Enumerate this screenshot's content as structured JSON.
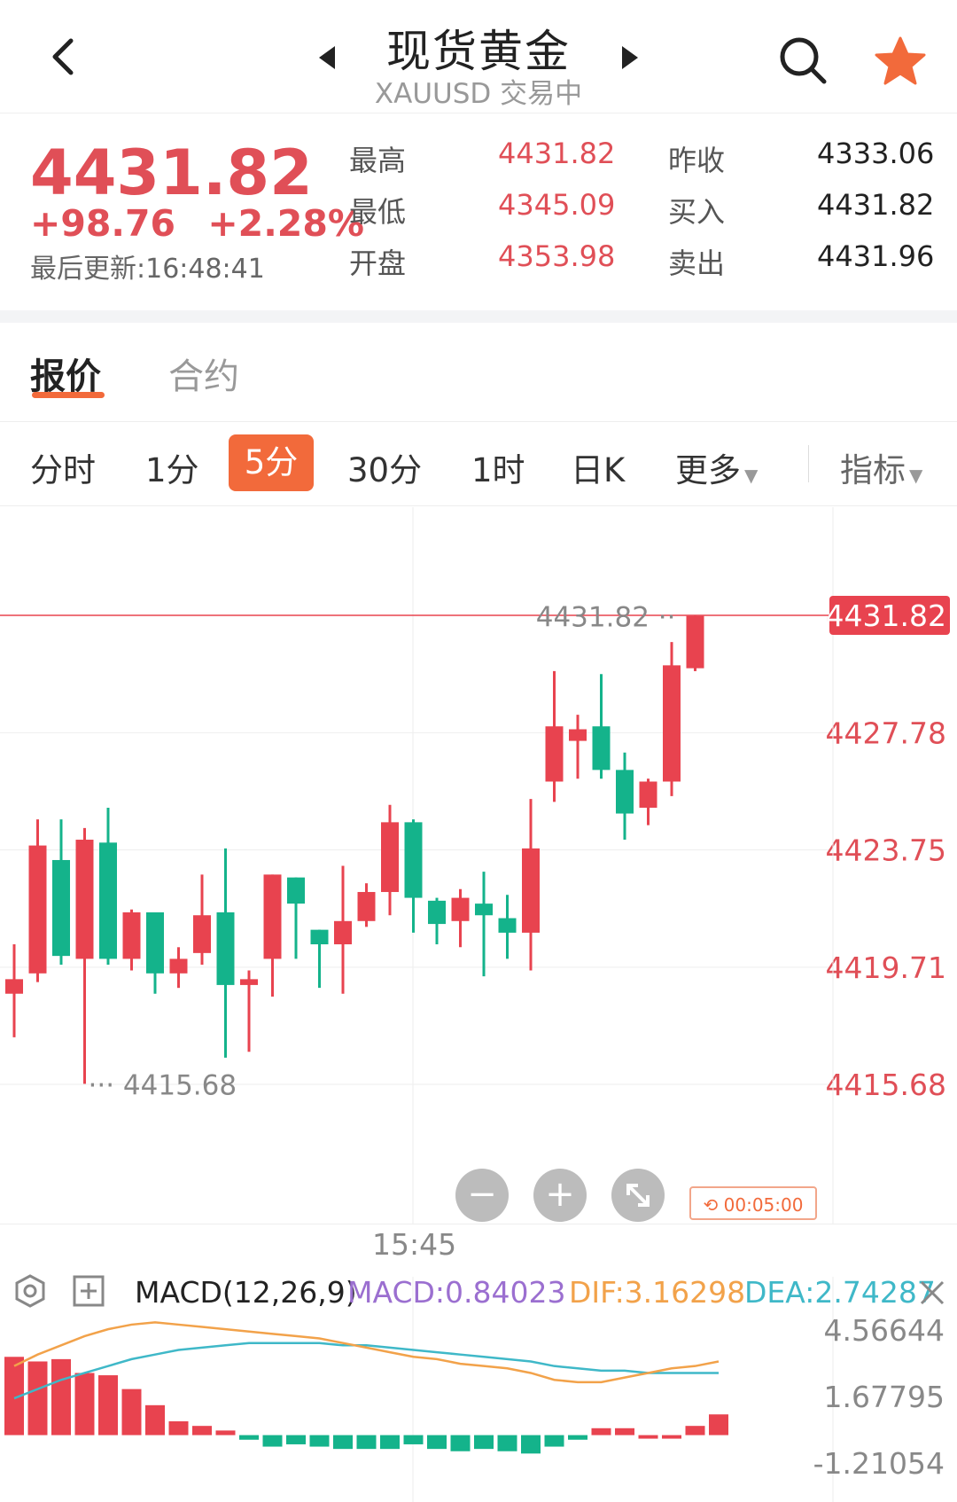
{
  "header": {
    "title": "现货黄金",
    "subtitle": "XAUUSD 交易中",
    "back_icon": "back-chevron-icon",
    "prev_icon": "prev-arrow-icon",
    "next_icon": "next-arrow-icon",
    "search_icon": "search-icon",
    "star_icon": "star-icon"
  },
  "quote": {
    "price": "4431.82",
    "change": "+98.76",
    "change_pct": "+2.28%",
    "updated": "最后更新:16:48:41",
    "high_label": "最高",
    "high": "4431.82",
    "low_label": "最低",
    "low": "4345.09",
    "open_label": "开盘",
    "open": "4353.98",
    "prev_close_label": "昨收",
    "prev_close": "4333.06",
    "bid_label": "买入",
    "bid": "4431.82",
    "ask_label": "卖出",
    "ask": "4431.96"
  },
  "tabs": [
    "报价",
    "合约"
  ],
  "intervals": [
    "分时",
    "1分",
    "5分",
    "30分",
    "1时",
    "日K",
    "更多",
    "指标"
  ],
  "selected_interval": "5分",
  "colors": {
    "up": "#e8434f",
    "down": "#14b38b",
    "accent": "#f26a3b",
    "dif": "#f2a24a",
    "dea": "#3fb8c8",
    "macd": "#9b6fd0"
  },
  "chart_data": {
    "type": "candlestick",
    "interval": "5分",
    "y_ticks": [
      "4431.82",
      "4427.78",
      "4423.75",
      "4419.71",
      "4415.68"
    ],
    "ylim": [
      4415.68,
      4431.82
    ],
    "current_price_label": "4431.82",
    "max_label": "4431.82",
    "min_label": "4415.68",
    "x_tick": "15:45",
    "candles": [
      {
        "open": 4418.8,
        "close": 4419.3,
        "high": 4420.5,
        "low": 4417.3
      },
      {
        "open": 4419.5,
        "close": 4423.9,
        "high": 4424.8,
        "low": 4419.2
      },
      {
        "open": 4423.4,
        "close": 4420.1,
        "high": 4424.8,
        "low": 4419.8
      },
      {
        "open": 4420.0,
        "close": 4424.1,
        "high": 4424.5,
        "low": 4415.7
      },
      {
        "open": 4424.0,
        "close": 4420.0,
        "high": 4425.2,
        "low": 4419.8
      },
      {
        "open": 4420.0,
        "close": 4421.6,
        "high": 4421.7,
        "low": 4419.6
      },
      {
        "open": 4421.6,
        "close": 4419.5,
        "high": 4421.6,
        "low": 4418.8
      },
      {
        "open": 4419.5,
        "close": 4420.0,
        "high": 4420.4,
        "low": 4419.0
      },
      {
        "open": 4420.2,
        "close": 4421.5,
        "high": 4422.9,
        "low": 4419.8
      },
      {
        "open": 4421.6,
        "close": 4419.1,
        "high": 4423.8,
        "low": 4416.6
      },
      {
        "open": 4419.1,
        "close": 4419.3,
        "high": 4419.6,
        "low": 4416.8
      },
      {
        "open": 4420.0,
        "close": 4422.9,
        "high": 4422.9,
        "low": 4418.7
      },
      {
        "open": 4422.8,
        "close": 4421.9,
        "high": 4422.8,
        "low": 4420.0
      },
      {
        "open": 4421.0,
        "close": 4420.5,
        "high": 4421.0,
        "low": 4419.0
      },
      {
        "open": 4420.5,
        "close": 4421.3,
        "high": 4423.2,
        "low": 4418.8
      },
      {
        "open": 4421.3,
        "close": 4422.3,
        "high": 4422.6,
        "low": 4421.1
      },
      {
        "open": 4422.3,
        "close": 4424.7,
        "high": 4425.3,
        "low": 4421.5
      },
      {
        "open": 4424.7,
        "close": 4422.1,
        "high": 4424.8,
        "low": 4420.9
      },
      {
        "open": 4422.0,
        "close": 4421.2,
        "high": 4422.1,
        "low": 4420.5
      },
      {
        "open": 4421.3,
        "close": 4422.1,
        "high": 4422.4,
        "low": 4420.4
      },
      {
        "open": 4421.9,
        "close": 4421.5,
        "high": 4423.0,
        "low": 4419.4
      },
      {
        "open": 4421.4,
        "close": 4420.9,
        "high": 4422.2,
        "low": 4420.0
      },
      {
        "open": 4420.9,
        "close": 4423.8,
        "high": 4425.5,
        "low": 4419.6
      },
      {
        "open": 4426.1,
        "close": 4428.0,
        "high": 4429.9,
        "low": 4425.4
      },
      {
        "open": 4427.5,
        "close": 4427.9,
        "high": 4428.4,
        "low": 4426.2
      },
      {
        "open": 4428.0,
        "close": 4426.5,
        "high": 4429.8,
        "low": 4426.2
      },
      {
        "open": 4426.5,
        "close": 4425.0,
        "high": 4427.1,
        "low": 4424.1
      },
      {
        "open": 4425.2,
        "close": 4426.1,
        "high": 4426.2,
        "low": 4424.6
      },
      {
        "open": 4426.1,
        "close": 4430.1,
        "high": 4430.9,
        "low": 4425.6
      },
      {
        "open": 4430.0,
        "close": 4431.8,
        "high": 4431.8,
        "low": 4429.9
      }
    ]
  },
  "macd": {
    "title": "MACD(12,26,9)",
    "macd_label": "MACD:0.84023",
    "dif_label": "DIF:3.16298",
    "dea_label": "DEA:2.74287",
    "close_icon": "close-icon",
    "settings_icon": "settings-icon",
    "add_icon": "add-icon",
    "y_ticks": [
      "4.56644",
      "1.67795",
      "-1.21054"
    ],
    "ylim": [
      -1.21054,
      4.56644
    ],
    "histogram": [
      3.4,
      3.2,
      3.3,
      2.7,
      2.6,
      2.0,
      1.3,
      0.6,
      0.4,
      0.2,
      -0.2,
      -0.5,
      -0.4,
      -0.5,
      -0.6,
      -0.6,
      -0.6,
      -0.4,
      -0.6,
      -0.7,
      -0.6,
      -0.7,
      -0.8,
      -0.5,
      -0.2,
      0.3,
      0.3,
      0.0,
      0.0,
      0.4,
      0.9
    ],
    "dif": [
      3.0,
      3.5,
      3.9,
      4.3,
      4.6,
      4.8,
      4.9,
      4.8,
      4.7,
      4.6,
      4.5,
      4.4,
      4.3,
      4.2,
      4.0,
      3.8,
      3.6,
      3.4,
      3.3,
      3.1,
      3.0,
      2.9,
      2.7,
      2.4,
      2.3,
      2.3,
      2.5,
      2.7,
      2.9,
      3.0,
      3.2
    ],
    "dea": [
      1.6,
      2.0,
      2.4,
      2.7,
      3.0,
      3.3,
      3.5,
      3.7,
      3.8,
      3.9,
      4.0,
      4.0,
      4.0,
      4.0,
      3.9,
      3.9,
      3.8,
      3.7,
      3.6,
      3.5,
      3.4,
      3.3,
      3.2,
      3.0,
      2.9,
      2.8,
      2.8,
      2.7,
      2.7,
      2.7,
      2.7
    ]
  },
  "controls": {
    "zoom_out": "−",
    "zoom_in": "+",
    "fullscreen_icon": "expand-icon",
    "timer": "00:05:00"
  }
}
